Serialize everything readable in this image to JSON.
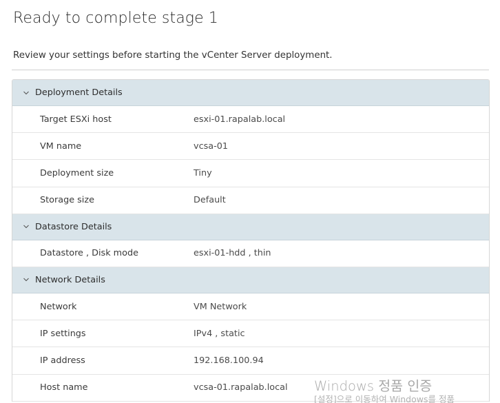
{
  "page": {
    "title": "Ready to complete stage 1",
    "subtitle": "Review your settings before starting the vCenter Server deployment."
  },
  "sections": [
    {
      "label": "Deployment Details",
      "expanded": true,
      "rows": [
        {
          "key": "Target ESXi host",
          "value": "esxi-01.rapalab.local"
        },
        {
          "key": "VM name",
          "value": "vcsa-01"
        },
        {
          "key": "Deployment size",
          "value": "Tiny"
        },
        {
          "key": "Storage size",
          "value": "Default"
        }
      ]
    },
    {
      "label": "Datastore Details",
      "expanded": true,
      "rows": [
        {
          "key": "Datastore , Disk mode",
          "value": "esxi-01-hdd , thin"
        }
      ]
    },
    {
      "label": "Network Details",
      "expanded": true,
      "rows": [
        {
          "key": "Network",
          "value": "VM Network"
        },
        {
          "key": "IP settings",
          "value": "IPv4 , static"
        },
        {
          "key": "IP address",
          "value": "192.168.100.94"
        },
        {
          "key": "Host name",
          "value": "vcsa-01.rapalab.local"
        }
      ]
    }
  ],
  "watermark": {
    "line1": "Windows 정품 인증",
    "line2": "[설정]으로 이동하여 Windows를 정품"
  },
  "colors": {
    "section_header_bg": "#d9e4ea",
    "row_bg": "#ffffff",
    "border": "#e4e4e4"
  },
  "icons": {
    "section_toggle": "chevron-down-icon"
  }
}
